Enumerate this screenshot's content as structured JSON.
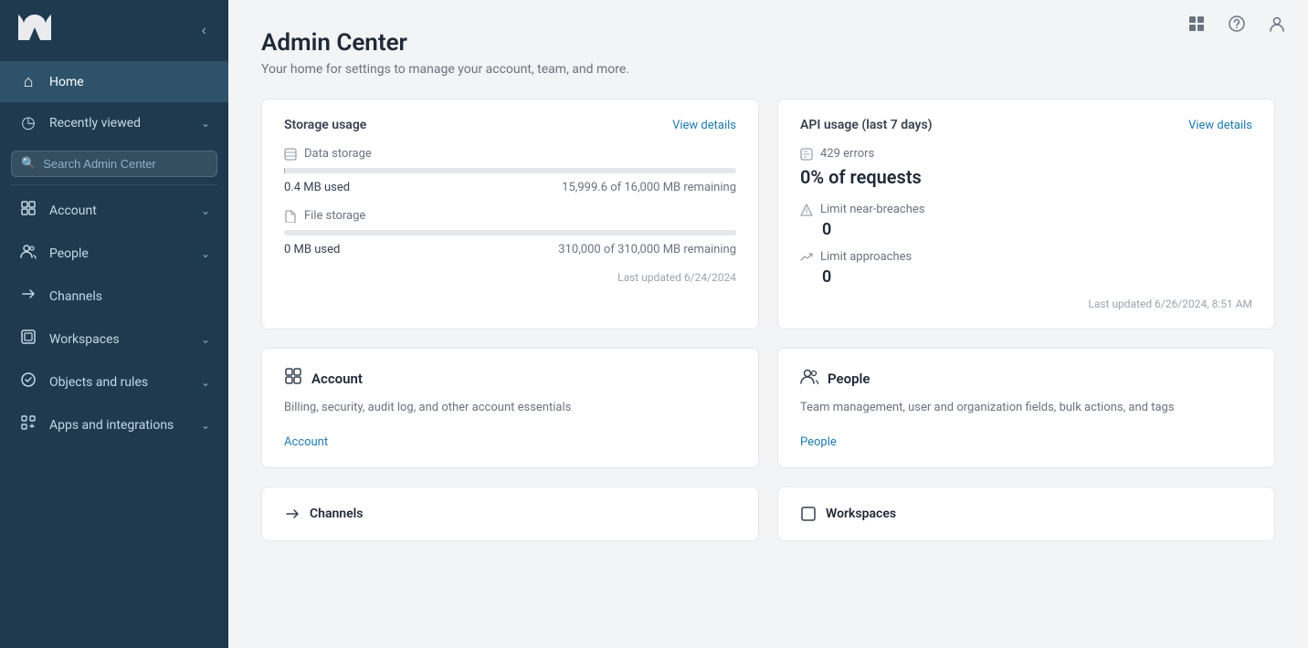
{
  "app": {
    "title": "Admin Center",
    "subtitle": "Your home for settings to manage your account, team, and more."
  },
  "topbar": {
    "grid_icon": "⊞",
    "help_icon": "?",
    "user_icon": "👤"
  },
  "sidebar": {
    "logo": "⌁",
    "home_label": "Home",
    "recently_viewed_label": "Recently viewed",
    "search_placeholder": "Search Admin Center",
    "items": [
      {
        "id": "account",
        "label": "Account",
        "has_chevron": true
      },
      {
        "id": "people",
        "label": "People",
        "has_chevron": true
      },
      {
        "id": "channels",
        "label": "Channels",
        "has_chevron": false
      },
      {
        "id": "workspaces",
        "label": "Workspaces",
        "has_chevron": true
      },
      {
        "id": "objects-rules",
        "label": "Objects and rules",
        "has_chevron": true
      },
      {
        "id": "apps-integrations",
        "label": "Apps and integrations",
        "has_chevron": true
      }
    ]
  },
  "storage_card": {
    "title": "Storage usage",
    "view_details": "View details",
    "data_storage_label": "Data storage",
    "data_used": "0.4 MB used",
    "data_remaining": "15,999.6 of 16,000 MB remaining",
    "data_fill_pct": 0.003,
    "file_storage_label": "File storage",
    "file_used": "0 MB used",
    "file_remaining": "310,000 of 310,000 MB remaining",
    "file_fill_pct": 0,
    "last_updated": "Last updated 6/24/2024"
  },
  "api_card": {
    "title": "API usage (last 7 days)",
    "view_details": "View details",
    "errors_label": "429 errors",
    "requests_pct": "0% of requests",
    "near_breaches_label": "Limit near-breaches",
    "near_breaches_value": "0",
    "approaches_label": "Limit approaches",
    "approaches_value": "0",
    "last_updated": "Last updated 6/26/2024, 8:51 AM"
  },
  "feature_cards": [
    {
      "id": "account",
      "icon": "▣",
      "title": "Account",
      "description": "Billing, security, audit log, and other account essentials",
      "link": "Account"
    },
    {
      "id": "people",
      "icon": "👥",
      "title": "People",
      "description": "Team management, user and organization fields, bulk actions, and tags",
      "link": "People"
    }
  ],
  "bottom_cards": [
    {
      "id": "channels",
      "icon": "⇄",
      "title": "Channels"
    },
    {
      "id": "workspaces",
      "icon": "⬜",
      "title": "Workspaces"
    }
  ]
}
